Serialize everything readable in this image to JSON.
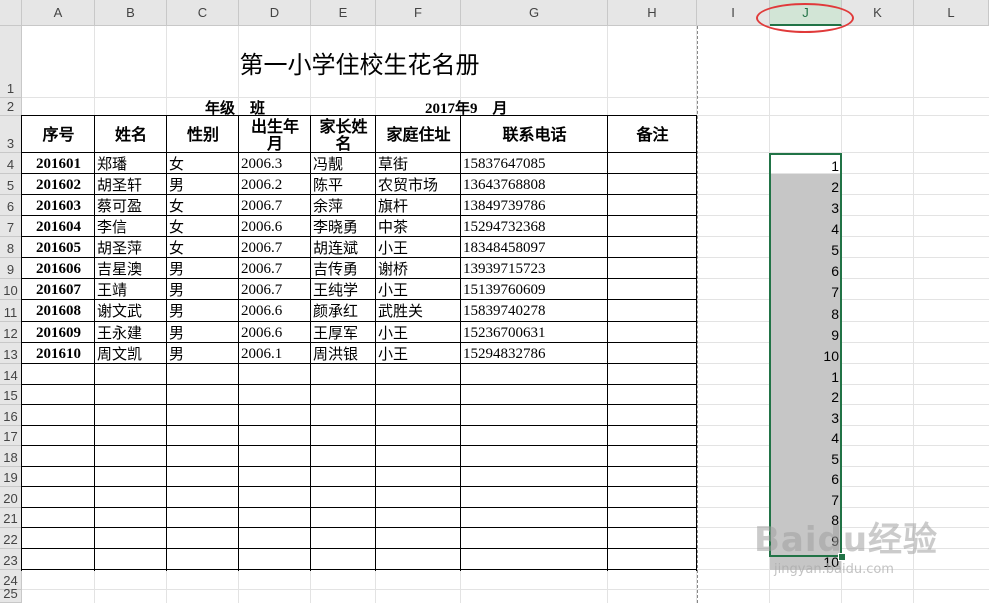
{
  "columns": [
    "A",
    "B",
    "C",
    "D",
    "E",
    "F",
    "G",
    "H",
    "I",
    "J",
    "K",
    "L"
  ],
  "selected_column": "J",
  "rows": [
    "1",
    "2",
    "3",
    "4",
    "5",
    "6",
    "7",
    "8",
    "9",
    "10",
    "11",
    "12",
    "13",
    "14",
    "15",
    "16",
    "17",
    "18",
    "19",
    "20",
    "21",
    "22",
    "23",
    "24",
    "25"
  ],
  "roster": {
    "title": "第一小学住校生花名册",
    "grade_class": "年级    班",
    "date": "2017年9    月",
    "headers": [
      "序号",
      "姓名",
      "性别",
      "出生年月",
      "家长姓名",
      "家庭住址",
      "联系电话",
      "备注"
    ],
    "records": [
      [
        "201601",
        "郑璠",
        "女",
        "2006.3",
        "冯靓",
        "草街",
        "15837647085",
        ""
      ],
      [
        "201602",
        "胡圣轩",
        "男",
        "2006.2",
        "陈平",
        "农贸市场",
        "13643768808",
        ""
      ],
      [
        "201603",
        "蔡可盈",
        "女",
        "2006.7",
        "余萍",
        "旗杆",
        "13849739786",
        ""
      ],
      [
        "201604",
        "李信",
        "女",
        "2006.6",
        "李晓勇",
        "中茶",
        "15294732368",
        ""
      ],
      [
        "201605",
        "胡圣萍",
        "女",
        "2006.7",
        "胡连斌",
        "小王",
        "18348458097",
        ""
      ],
      [
        "201606",
        "吉星澳",
        "男",
        "2006.7",
        "吉传勇",
        "谢桥",
        "13939715723",
        ""
      ],
      [
        "201607",
        "王靖",
        "男",
        "2006.7",
        "王纯学",
        "小王",
        "15139760609",
        ""
      ],
      [
        "201608",
        "谢文武",
        "男",
        "2006.6",
        "颜承红",
        "武胜关",
        "15839740278",
        ""
      ],
      [
        "201609",
        "王永建",
        "男",
        "2006.6",
        "王厚军",
        "小王",
        "15236700631",
        ""
      ],
      [
        "201610",
        "周文凯",
        "男",
        "2006.1",
        "周洪银",
        "小王",
        "15294832786",
        ""
      ]
    ]
  },
  "column_j_values": [
    "1",
    "2",
    "3",
    "4",
    "5",
    "6",
    "7",
    "8",
    "9",
    "10",
    "1",
    "2",
    "3",
    "4",
    "5",
    "6",
    "7",
    "8",
    "9",
    "10"
  ],
  "watermark": {
    "brand": "Baidu经验",
    "url": "jingyan.baidu.com"
  },
  "colors": {
    "selection": "#217346",
    "highlight": "#c6c6c6",
    "annotation": "#e03a3a"
  }
}
